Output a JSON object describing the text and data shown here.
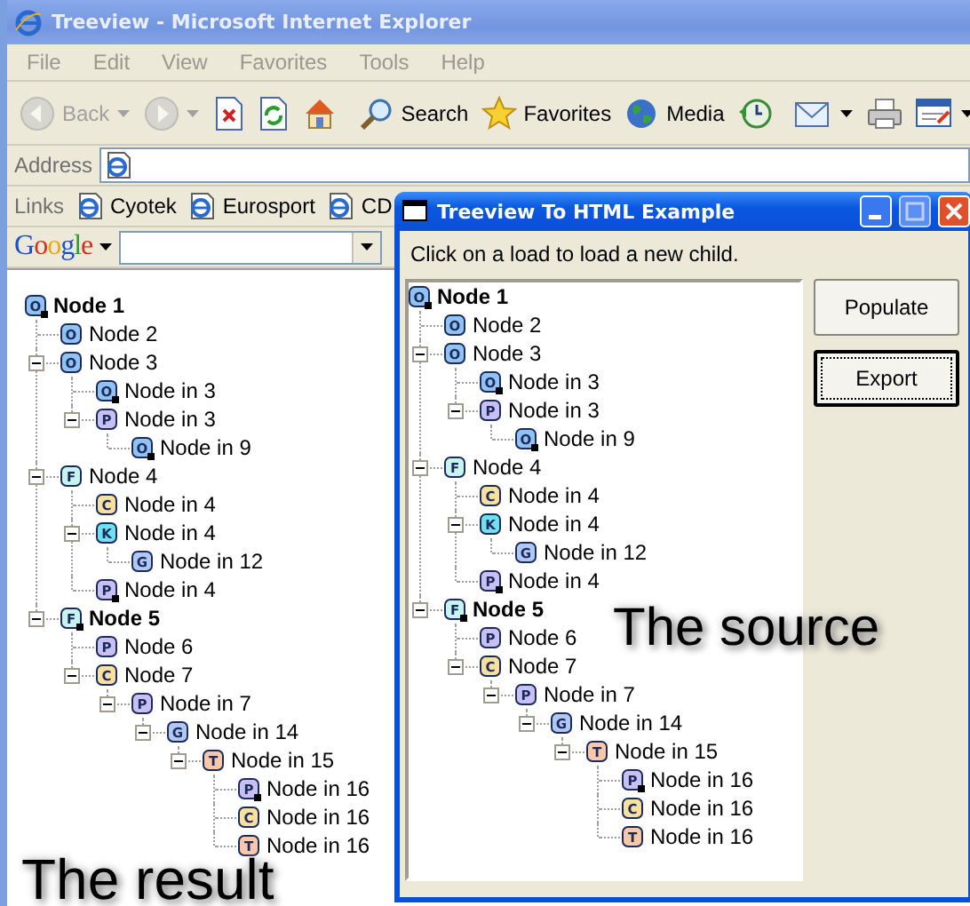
{
  "ie_window": {
    "title": "Treeview - Microsoft Internet Explorer",
    "menu": [
      "File",
      "Edit",
      "View",
      "Favorites",
      "Tools",
      "Help"
    ],
    "toolbar": [
      {
        "kind": "back",
        "label": "Back",
        "disabled": true,
        "dropdown": true
      },
      {
        "kind": "forward",
        "disabled": true,
        "dropdown": true
      },
      {
        "kind": "stop",
        "disabled": false,
        "dropdown": false
      },
      {
        "kind": "refresh",
        "disabled": false,
        "dropdown": false
      },
      {
        "kind": "home",
        "disabled": false,
        "dropdown": false
      },
      {
        "kind": "search",
        "label": "Search",
        "disabled": false,
        "dropdown": false
      },
      {
        "kind": "favorites",
        "label": "Favorites",
        "disabled": false,
        "dropdown": false
      },
      {
        "kind": "media",
        "label": "Media",
        "disabled": false,
        "dropdown": false
      },
      {
        "kind": "history",
        "disabled": false,
        "dropdown": false
      },
      {
        "kind": "mail",
        "disabled": false,
        "dropdown": true
      },
      {
        "kind": "print",
        "disabled": false,
        "dropdown": false
      },
      {
        "kind": "edit",
        "disabled": false,
        "dropdown": true
      }
    ],
    "address_label": "Address",
    "links_label": "Links",
    "links": [
      "Cyotek",
      "Eurosport",
      "CD"
    ],
    "google_logo": "Google"
  },
  "result_tree": {
    "label": "Node 1",
    "icon": "O",
    "color": "#8ec3f4",
    "marked": true,
    "bold": true,
    "children": [
      {
        "label": "Node 2",
        "icon": "O",
        "color": "#8ec3f4"
      },
      {
        "label": "Node 3",
        "icon": "O",
        "color": "#8ec3f4",
        "expanded": true,
        "children": [
          {
            "label": "Node in 3",
            "icon": "O",
            "color": "#8ec3f4",
            "marked": true
          },
          {
            "label": "Node in 3",
            "icon": "P",
            "color": "#c8c0f4",
            "expanded": true,
            "children": [
              {
                "label": "Node in 9",
                "icon": "O",
                "color": "#8ec3f4",
                "marked": true
              }
            ]
          }
        ]
      },
      {
        "label": "Node 4",
        "icon": "F",
        "color": "#c8f4f0",
        "expanded": true,
        "children": [
          {
            "label": "Node in 4",
            "icon": "C",
            "color": "#f8e0a0"
          },
          {
            "label": "Node in 4",
            "icon": "K",
            "color": "#70e0f0",
            "expanded": true,
            "children": [
              {
                "label": "Node in 12",
                "icon": "G",
                "color": "#b0c8f4"
              }
            ]
          },
          {
            "label": "Node in 4",
            "icon": "P",
            "color": "#c8c0f4",
            "marked": true
          }
        ]
      },
      {
        "label": "Node 5",
        "icon": "F",
        "color": "#c8f4f0",
        "marked": true,
        "bold": true,
        "expanded": true,
        "children": [
          {
            "label": "Node 6",
            "icon": "P",
            "color": "#c8c0f4"
          },
          {
            "label": "Node 7",
            "icon": "C",
            "color": "#f8e0a0",
            "expanded": true,
            "children": [
              {
                "label": "Node in 7",
                "icon": "P",
                "color": "#c8c0f4",
                "expanded": true,
                "children": [
                  {
                    "label": "Node in 14",
                    "icon": "G",
                    "color": "#b0c8f4",
                    "expanded": true,
                    "children": [
                      {
                        "label": "Node in 15",
                        "icon": "T",
                        "color": "#f8c8a8",
                        "expanded": true,
                        "children": [
                          {
                            "label": "Node in 16",
                            "icon": "P",
                            "color": "#c8c0f4",
                            "marked": true
                          },
                          {
                            "label": "Node in 16",
                            "icon": "C",
                            "color": "#f8e0a0"
                          },
                          {
                            "label": "Node in 16",
                            "icon": "T",
                            "color": "#f8c8a8"
                          }
                        ]
                      }
                    ]
                  }
                ]
              }
            ]
          }
        ]
      }
    ]
  },
  "result_caption": "The result",
  "dialog": {
    "title": "Treeview To HTML Example",
    "instruction": "Click on a load to load a new child.",
    "buttons": [
      {
        "label": "Populate",
        "focused": false
      },
      {
        "label": "Export",
        "focused": true
      }
    ]
  },
  "source_tree": {
    "label": "Node 1",
    "icon": "O",
    "color": "#8ec3f4",
    "marked": true,
    "bold": true,
    "children": [
      {
        "label": "Node 2",
        "icon": "O",
        "color": "#8ec3f4"
      },
      {
        "label": "Node 3",
        "icon": "O",
        "color": "#8ec3f4",
        "expanded": true,
        "children": [
          {
            "label": "Node in 3",
            "icon": "O",
            "color": "#8ec3f4",
            "marked": true
          },
          {
            "label": "Node in 3",
            "icon": "P",
            "color": "#c8c0f4",
            "expanded": true,
            "children": [
              {
                "label": "Node in 9",
                "icon": "O",
                "color": "#8ec3f4",
                "marked": true
              }
            ]
          }
        ]
      },
      {
        "label": "Node 4",
        "icon": "F",
        "color": "#c8f4f0",
        "expanded": true,
        "children": [
          {
            "label": "Node in 4",
            "icon": "C",
            "color": "#f8e0a0"
          },
          {
            "label": "Node in 4",
            "icon": "K",
            "color": "#70e0f0",
            "expanded": true,
            "children": [
              {
                "label": "Node in 12",
                "icon": "G",
                "color": "#b0c8f4"
              }
            ]
          },
          {
            "label": "Node in 4",
            "icon": "P",
            "color": "#c8c0f4",
            "marked": true
          }
        ]
      },
      {
        "label": "Node 5",
        "icon": "F",
        "color": "#c8f4f0",
        "marked": true,
        "bold": true,
        "expanded": true,
        "children": [
          {
            "label": "Node 6",
            "icon": "P",
            "color": "#c8c0f4"
          },
          {
            "label": "Node 7",
            "icon": "C",
            "color": "#f8e0a0",
            "expanded": true,
            "children": [
              {
                "label": "Node in 7",
                "icon": "P",
                "color": "#c8c0f4",
                "expanded": true,
                "children": [
                  {
                    "label": "Node in 14",
                    "icon": "G",
                    "color": "#b0c8f4",
                    "expanded": true,
                    "children": [
                      {
                        "label": "Node in 15",
                        "icon": "T",
                        "color": "#f8c8a8",
                        "expanded": true,
                        "children": [
                          {
                            "label": "Node in 16",
                            "icon": "P",
                            "color": "#c8c0f4",
                            "marked": true
                          },
                          {
                            "label": "Node in 16",
                            "icon": "C",
                            "color": "#f8e0a0"
                          },
                          {
                            "label": "Node in 16",
                            "icon": "T",
                            "color": "#f8c8a8"
                          }
                        ]
                      }
                    ]
                  }
                ]
              }
            ]
          }
        ]
      }
    ]
  },
  "source_caption": "The source"
}
